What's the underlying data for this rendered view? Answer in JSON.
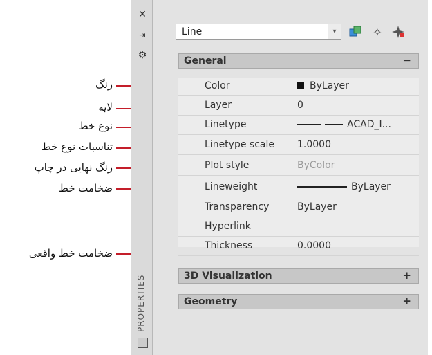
{
  "annotations": [
    {
      "label": "رنگ"
    },
    {
      "label": "لایه"
    },
    {
      "label": "نوع خط"
    },
    {
      "label": "تناسبات نوع خط"
    },
    {
      "label": "رنگ نهایی در چاپ"
    },
    {
      "label": "ضخامت خط"
    },
    {
      "label": "ضخامت خط واقعی"
    }
  ],
  "palette": {
    "title": "PROPERTIES",
    "side_icons": [
      "close-icon",
      "autohide-icon",
      "settings-icon"
    ],
    "object_selector": {
      "value": "Line"
    },
    "toolbar_icons": [
      "toggle-pickadd-icon",
      "select-objects-icon",
      "quick-select-icon"
    ],
    "sections": {
      "general": {
        "label": "General",
        "state": "−"
      },
      "viz3d": {
        "label": "3D Visualization",
        "state": "+"
      },
      "geometry": {
        "label": "Geometry",
        "state": "+"
      }
    },
    "properties": [
      {
        "key": "Color",
        "value": "ByLayer"
      },
      {
        "key": "Layer",
        "value": "0"
      },
      {
        "key": "Linetype",
        "value": "ACAD_I..."
      },
      {
        "key": "Linetype scale",
        "value": "1.0000"
      },
      {
        "key": "Plot style",
        "value": "ByColor"
      },
      {
        "key": "Lineweight",
        "value": "ByLayer"
      },
      {
        "key": "Transparency",
        "value": "ByLayer"
      },
      {
        "key": "Hyperlink",
        "value": ""
      },
      {
        "key": "Thickness",
        "value": "0.0000"
      }
    ]
  },
  "colors": {
    "arrow": "#c41e2a",
    "palette_bg": "#e3e3e3",
    "section_bg": "#c7c7c7"
  }
}
